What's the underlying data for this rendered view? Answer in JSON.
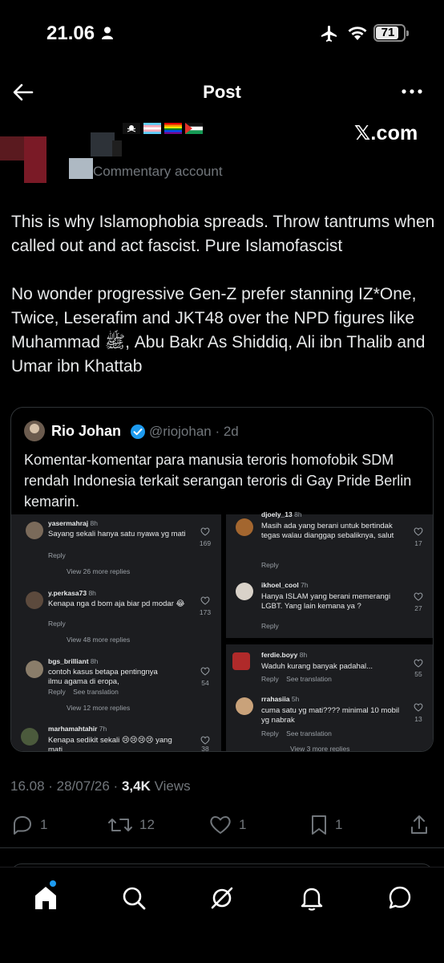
{
  "status_bar": {
    "time": "21.06",
    "battery": "71"
  },
  "header": {
    "title": "Post"
  },
  "author": {
    "subtitle": "Commentary account",
    "source_logo": "𝕏.com"
  },
  "post": {
    "paragraph1": "This is why Islamophobia spreads. Throw tantrums when called out and act fascist. Pure Islamofascist",
    "paragraph2": "No wonder progressive Gen-Z prefer stanning IZ*One, Twice, Leserafim and JKT48 over the NPD figures like Muhammad ﷺ, Abu Bakr As Shiddiq, Ali ibn Thalib and Umar ibn Khattab"
  },
  "quote": {
    "name": "Rio Johan",
    "handle": "@riojohan · 2d",
    "text": "Komentar-komentar para manusia teroris homofobik SDM rendah Indonesia terkait serangan teroris di Gay Pride Berlin kemarin.",
    "comments_left": [
      {
        "user": "yasermahraj",
        "time": "8h",
        "body": "Sayang sekali hanya satu nyawa yg mati",
        "reply": "Reply",
        "more": "View 26 more replies",
        "likes": "169"
      },
      {
        "user": "y.perkasa73",
        "time": "8h",
        "body": "Kenapa nga d bom aja biar pd modar 😂",
        "reply": "Reply",
        "more": "View 48 more replies",
        "likes": "173"
      },
      {
        "user": "bgs_brilliant",
        "time": "8h",
        "body": "contoh kasus betapa pentingnya ilmu agama di eropa,",
        "reply": "Reply    See translation",
        "more": "View 12 more replies",
        "likes": "54"
      },
      {
        "user": "marhamahtahir",
        "time": "7h",
        "body": "Kenapa sedikit sekali 😢😢😢😢 yang mati",
        "reply": "",
        "more": "",
        "likes": "38"
      }
    ],
    "comments_right": [
      {
        "user": "djoely_13",
        "time": "8h",
        "body": "Masih ada yang berani untuk bertindak tegas walau dianggap sebaliknya, salut",
        "reply": "Reply",
        "more": "",
        "likes": "17"
      },
      {
        "user": "ikhoel_cool",
        "time": "7h",
        "body": "Hanya ISLAM yang berani memerangi LGBT.  Yang lain kemana ya ?",
        "reply": "Reply",
        "more": "",
        "likes": "27"
      },
      {
        "user": "ferdie.boyy",
        "time": "8h",
        "body": "Waduh kurang banyak padahal...",
        "reply": "Reply    See translation",
        "more": "",
        "likes": "55"
      },
      {
        "user": "rrahasiia",
        "time": "5h",
        "body": "cuma satu yg mati???? minimal 10 mobil yg nabrak",
        "reply": "Reply    See translation",
        "more": "View 3 more replies",
        "likes": "13"
      }
    ]
  },
  "meta": {
    "datetime": "16.08 · 28/07/26 · ",
    "views_count": "3,4K",
    "views_label": " Views"
  },
  "actions": {
    "replies": "1",
    "reposts": "12",
    "likes": "1",
    "bookmarks": "1"
  },
  "colors": {
    "background": "#000000",
    "text": "#e7e9ea",
    "muted": "#71767b",
    "accent": "#1d9bf0",
    "panel": "#1c1d20"
  },
  "icons": [
    "back-arrow-icon",
    "more-icon",
    "reply-icon",
    "repost-icon",
    "like-icon",
    "bookmark-icon",
    "share-icon",
    "home-icon",
    "search-icon",
    "grok-icon",
    "notifications-icon",
    "messages-icon"
  ]
}
